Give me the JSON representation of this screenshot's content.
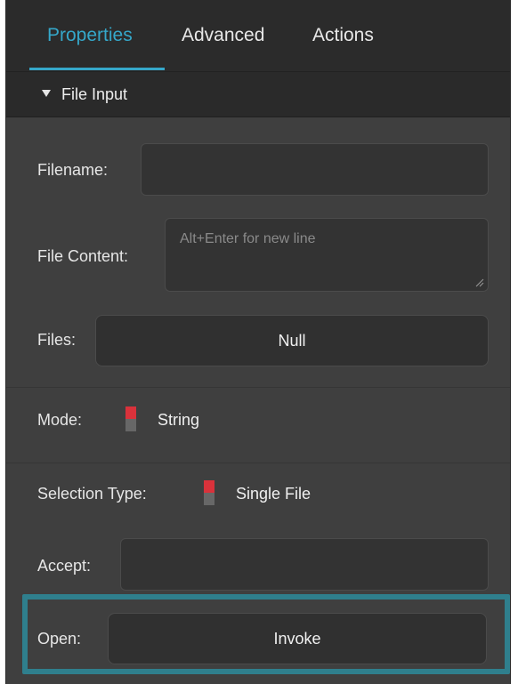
{
  "tabs": [
    {
      "label": "Properties",
      "active": true
    },
    {
      "label": "Advanced",
      "active": false
    },
    {
      "label": "Actions",
      "active": false
    }
  ],
  "section": {
    "title": "File Input",
    "icon": "triangle-down-icon"
  },
  "fields": {
    "filename_label": "Filename:",
    "filename_value": "",
    "file_content_label": "File Content:",
    "file_content_placeholder": "Alt+Enter for new line",
    "files_label": "Files:",
    "files_value": "Null",
    "mode_label": "Mode:",
    "mode_value": "String",
    "selection_type_label": "Selection Type:",
    "selection_type_value": "Single File",
    "accept_label": "Accept:",
    "accept_value": "",
    "open_label": "Open:",
    "open_value": "Invoke"
  },
  "colors": {
    "accent": "#35a7c9",
    "toggle_on": "#d9323b",
    "toggle_off": "#676767",
    "highlight_border": "#2f7f8d",
    "panel_bg": "#3f3f3f"
  }
}
